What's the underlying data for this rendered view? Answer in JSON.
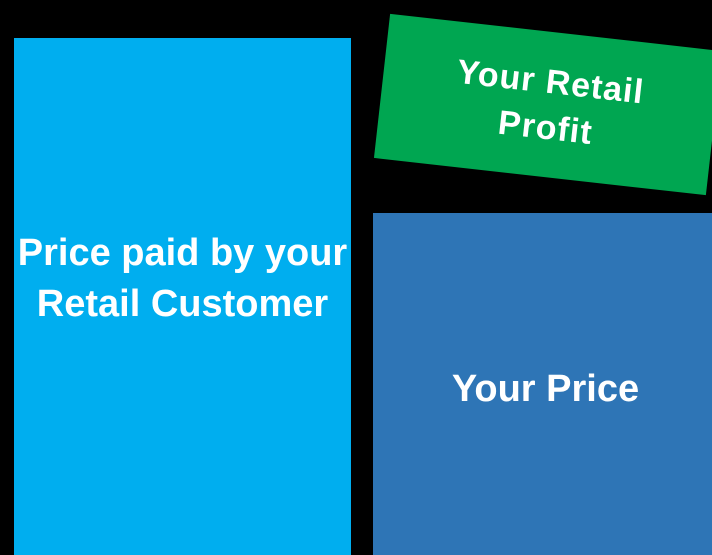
{
  "blocks": {
    "retail_customer_price": {
      "label": "Price paid by your Retail Customer",
      "color": "#00AEEF"
    },
    "your_price": {
      "label": "Your Price",
      "color": "#2E75B6"
    },
    "retail_profit": {
      "label": "Your Retail Profit",
      "color": "#00A651"
    }
  },
  "background_color": "#000000"
}
